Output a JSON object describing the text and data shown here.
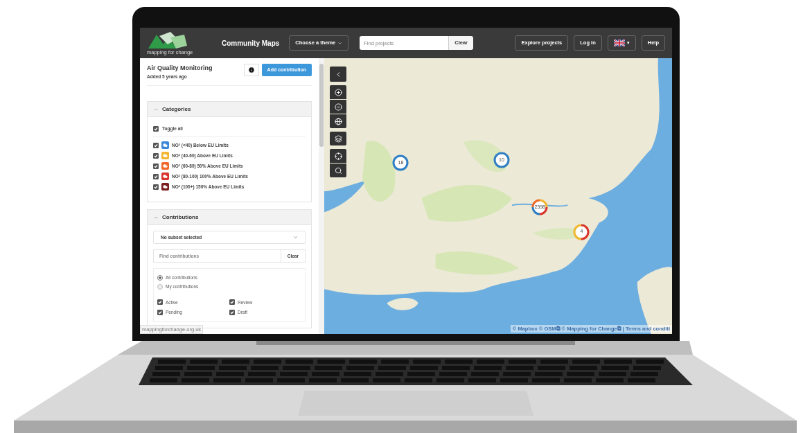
{
  "navbar": {
    "logo_text": "mapping for change",
    "title": "Community Maps",
    "theme_menu": "Choose a theme",
    "search": {
      "placeholder": "Find projects"
    },
    "clear": "Clear",
    "buttons": [
      "Explore projects",
      "Log in"
    ],
    "language_caret": "▾",
    "help": "Help"
  },
  "project": {
    "title": "Air Quality Monitoring",
    "subtitle": "Added 5 years ago",
    "add": "Add contribution"
  },
  "categories": {
    "title": "Categories",
    "expanded": true,
    "toggle_all": {
      "label": "Toggle all",
      "checked": true
    },
    "items": [
      {
        "label": "NO² (<40) Below EU Limits",
        "checked": true,
        "color": "#3a87d8"
      },
      {
        "label": "NO² (40-60) Above EU Limits",
        "checked": true,
        "color": "#f2b630"
      },
      {
        "label": "NO² (60-80) 50% Above EU Limits",
        "checked": true,
        "color": "#f0692a"
      },
      {
        "label": "NO² (80-100) 100% Above EU Limits",
        "checked": true,
        "color": "#d9342b"
      },
      {
        "label": "NO² (100+) 150% Above EU Limits",
        "checked": true,
        "color": "#7a1c1c"
      }
    ]
  },
  "contributions": {
    "title": "Contributions",
    "expanded": true,
    "subset": "No subset selected",
    "search": {
      "placeholder": "Find contributions"
    },
    "clear": "Clear",
    "scope": [
      {
        "label": "All contributions",
        "selected": true
      },
      {
        "label": "My contributions",
        "selected": false
      }
    ],
    "statuses": [
      {
        "label": "Active",
        "checked": true
      },
      {
        "label": "Review",
        "checked": true
      },
      {
        "label": "Pending",
        "checked": true
      },
      {
        "label": "Draft",
        "checked": true
      }
    ]
  },
  "status_url": "mappingforchange.org.uk",
  "map": {
    "clusters": [
      {
        "count": "18",
        "segments": [
          {
            "color": "#2f7fc4"
          }
        ]
      },
      {
        "count": "10",
        "segments": [
          {
            "color": "#2f7fc4"
          }
        ]
      },
      {
        "count": "2398",
        "segments": [
          {
            "color": "#f2b630"
          },
          {
            "color": "#d9342b"
          },
          {
            "color": "#2f7fc4"
          },
          {
            "color": "#f0692a"
          }
        ]
      },
      {
        "count": "4",
        "segments": [
          {
            "color": "#d9342b"
          },
          {
            "color": "#f2b630"
          }
        ]
      }
    ],
    "attribution": "© Mapbox © OSM⧉ © Mapping for Change⧉ | Terms and conditi"
  }
}
